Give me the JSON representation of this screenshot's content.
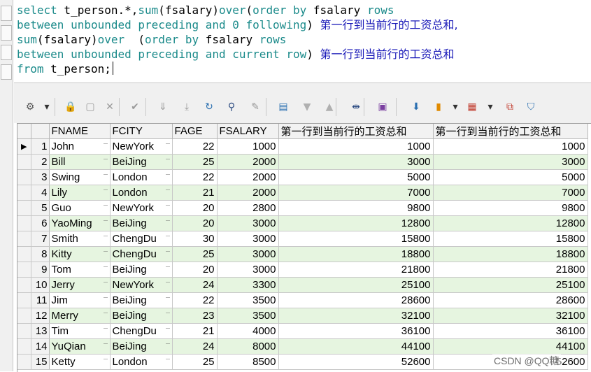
{
  "editor": {
    "lines": [
      [
        {
          "t": "select",
          "c": "kw"
        },
        {
          "t": " t_person.*,",
          "c": "tx"
        },
        {
          "t": "sum",
          "c": "kw"
        },
        {
          "t": "(fsalary)",
          "c": "tx"
        },
        {
          "t": "over",
          "c": "kw"
        },
        {
          "t": "(",
          "c": "tx"
        },
        {
          "t": "order by",
          "c": "kw"
        },
        {
          "t": " fsalary ",
          "c": "tx"
        },
        {
          "t": "rows",
          "c": "kw"
        }
      ],
      [
        {
          "t": "between unbounded preceding and 0 following",
          "c": "kw"
        },
        {
          "t": ") ",
          "c": "tx"
        },
        {
          "t": "第一行到当前行的工资总和,",
          "c": "cn"
        }
      ],
      [
        {
          "t": "sum",
          "c": "kw"
        },
        {
          "t": "(fsalary)",
          "c": "tx"
        },
        {
          "t": "over",
          "c": "kw"
        },
        {
          "t": "  (",
          "c": "tx"
        },
        {
          "t": "order by",
          "c": "kw"
        },
        {
          "t": " fsalary ",
          "c": "tx"
        },
        {
          "t": "rows",
          "c": "kw"
        }
      ],
      [
        {
          "t": "between unbounded preceding and current row",
          "c": "kw"
        },
        {
          "t": ") ",
          "c": "tx"
        },
        {
          "t": "第一行到当前行的工资总和",
          "c": "cn"
        }
      ],
      [
        {
          "t": "from",
          "c": "kw"
        },
        {
          "t": " t_person;",
          "c": "tx"
        }
      ]
    ]
  },
  "toolbar": {
    "buttons": [
      {
        "name": "grid-options-icon",
        "glyph": "⚙",
        "color": "#555555",
        "interactable": true
      },
      {
        "name": "dropdown-arrow-icon",
        "glyph": "▾",
        "color": "#333333",
        "interactable": true
      },
      {
        "name": "lock-icon",
        "glyph": "🔒",
        "color": "#c0392b",
        "interactable": true
      },
      {
        "name": "insert-record-icon",
        "glyph": "▢",
        "color": "#9a9a9a",
        "interactable": true
      },
      {
        "name": "delete-record-icon",
        "glyph": "✕",
        "color": "#9a9a9a",
        "interactable": true
      },
      {
        "name": "post-changes-icon",
        "glyph": "✔",
        "color": "#9a9a9a",
        "interactable": true
      },
      {
        "name": "next-record-icon",
        "glyph": "⇓",
        "color": "#9a9a9a",
        "interactable": true
      },
      {
        "name": "last-record-icon",
        "glyph": "⤓",
        "color": "#9a9a9a",
        "interactable": true
      },
      {
        "name": "refresh-icon",
        "glyph": "↻",
        "color": "#2a6fb0",
        "interactable": true
      },
      {
        "name": "find-icon",
        "glyph": "⚲",
        "color": "#2a4a80",
        "interactable": true
      },
      {
        "name": "clear-icon",
        "glyph": "✎",
        "color": "#9a9a9a",
        "interactable": true
      },
      {
        "name": "form-view-icon",
        "glyph": "▤",
        "color": "#2a6fb0",
        "interactable": true
      },
      {
        "name": "sort-desc-icon",
        "glyph": "▼",
        "color": "#b0b0b0",
        "interactable": true
      },
      {
        "name": "sort-asc-icon",
        "glyph": "▲",
        "color": "#b0b0b0",
        "interactable": true
      },
      {
        "name": "link-icon",
        "glyph": "⇹",
        "color": "#2a4a80",
        "interactable": true
      },
      {
        "name": "save-icon",
        "glyph": "▣",
        "color": "#7a3fa0",
        "interactable": true
      },
      {
        "name": "export-icon",
        "glyph": "⬇",
        "color": "#2a6fb0",
        "interactable": true
      },
      {
        "name": "chart-icon",
        "glyph": "▮",
        "color": "#e08a00",
        "interactable": true
      },
      {
        "name": "chart-dropdown-icon",
        "glyph": "▾",
        "color": "#333333",
        "interactable": true
      },
      {
        "name": "table-icon",
        "glyph": "▦",
        "color": "#c0392b",
        "interactable": true
      },
      {
        "name": "table-dropdown-icon",
        "glyph": "▾",
        "color": "#333333",
        "interactable": true
      },
      {
        "name": "copy-records-icon",
        "glyph": "⧉",
        "color": "#c0392b",
        "interactable": true
      },
      {
        "name": "filter-icon",
        "glyph": "⛉",
        "color": "#2a6fb0",
        "interactable": true
      }
    ]
  },
  "grid": {
    "columns": [
      "FNAME",
      "FCITY",
      "FAGE",
      "FSALARY",
      "第一行到当前行的工资总和",
      "第一行到当前行的工资总和"
    ],
    "rows": [
      [
        "1",
        "John",
        "NewYork",
        "22",
        "1000",
        "1000",
        "1000"
      ],
      [
        "2",
        "Bill",
        "BeiJing",
        "25",
        "2000",
        "3000",
        "3000"
      ],
      [
        "3",
        "Swing",
        "London",
        "22",
        "2000",
        "5000",
        "5000"
      ],
      [
        "4",
        "Lily",
        "London",
        "21",
        "2000",
        "7000",
        "7000"
      ],
      [
        "5",
        "Guo",
        "NewYork",
        "20",
        "2800",
        "9800",
        "9800"
      ],
      [
        "6",
        "YaoMing",
        "BeiJing",
        "20",
        "3000",
        "12800",
        "12800"
      ],
      [
        "7",
        "Smith",
        "ChengDu",
        "30",
        "3000",
        "15800",
        "15800"
      ],
      [
        "8",
        "Kitty",
        "ChengDu",
        "25",
        "3000",
        "18800",
        "18800"
      ],
      [
        "9",
        "Tom",
        "BeiJing",
        "20",
        "3000",
        "21800",
        "21800"
      ],
      [
        "10",
        "Jerry",
        "NewYork",
        "24",
        "3300",
        "25100",
        "25100"
      ],
      [
        "11",
        "Jim",
        "BeiJing",
        "22",
        "3500",
        "28600",
        "28600"
      ],
      [
        "12",
        "Merry",
        "BeiJing",
        "23",
        "3500",
        "32100",
        "32100"
      ],
      [
        "13",
        "Tim",
        "ChengDu",
        "21",
        "4000",
        "36100",
        "36100"
      ],
      [
        "14",
        "YuQian",
        "BeiJing",
        "24",
        "8000",
        "44100",
        "44100"
      ],
      [
        "15",
        "Ketty",
        "London",
        "25",
        "8500",
        "52600",
        "52600"
      ]
    ],
    "current_row_marker": "▶",
    "row_stripe_color": "#e6f5e0"
  },
  "watermark": "CSDN @QQ糖"
}
